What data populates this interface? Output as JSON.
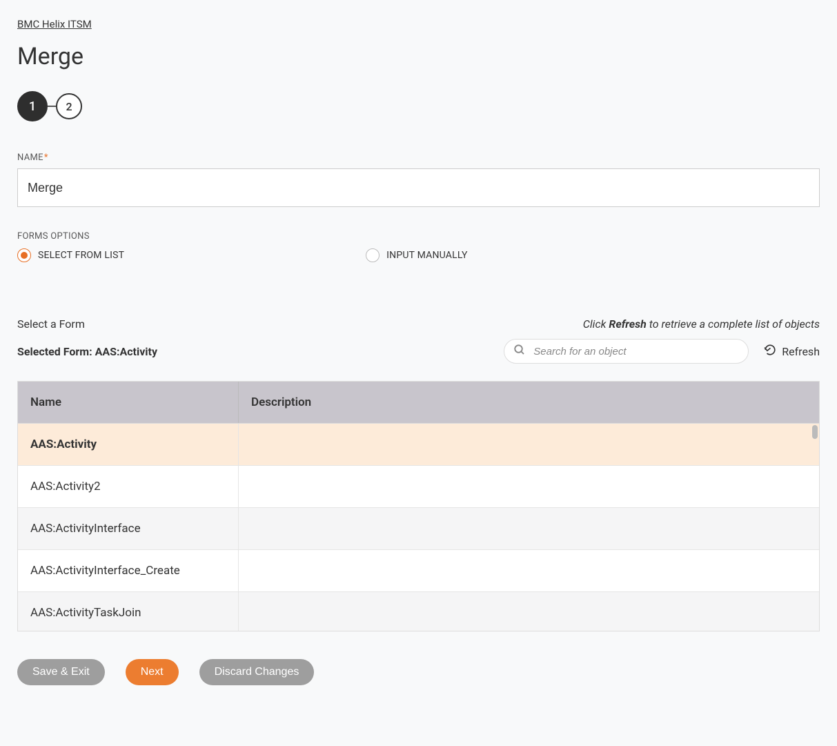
{
  "breadcrumb": "BMC Helix ITSM",
  "page_title": "Merge",
  "stepper": {
    "step1": "1",
    "step2": "2"
  },
  "name_field": {
    "label": "NAME",
    "value": "Merge"
  },
  "forms_options": {
    "label": "FORMS OPTIONS",
    "select_from_list": "SELECT FROM LIST",
    "input_manually": "INPUT MANUALLY"
  },
  "select_form": {
    "label": "Select a Form",
    "hint_prefix": "Click ",
    "hint_bold": "Refresh",
    "hint_suffix": " to retrieve a complete list of objects",
    "selected_label_prefix": "Selected Form: ",
    "selected_value": "AAS:Activity",
    "search_placeholder": "Search for an object",
    "refresh_label": "Refresh"
  },
  "table": {
    "headers": {
      "name": "Name",
      "description": "Description"
    },
    "rows": [
      {
        "name": "AAS:Activity",
        "description": "",
        "selected": true
      },
      {
        "name": "AAS:Activity2",
        "description": ""
      },
      {
        "name": "AAS:ActivityInterface",
        "description": ""
      },
      {
        "name": "AAS:ActivityInterface_Create",
        "description": ""
      },
      {
        "name": "AAS:ActivityTaskJoin",
        "description": ""
      }
    ]
  },
  "buttons": {
    "save_exit": "Save & Exit",
    "next": "Next",
    "discard": "Discard Changes"
  }
}
